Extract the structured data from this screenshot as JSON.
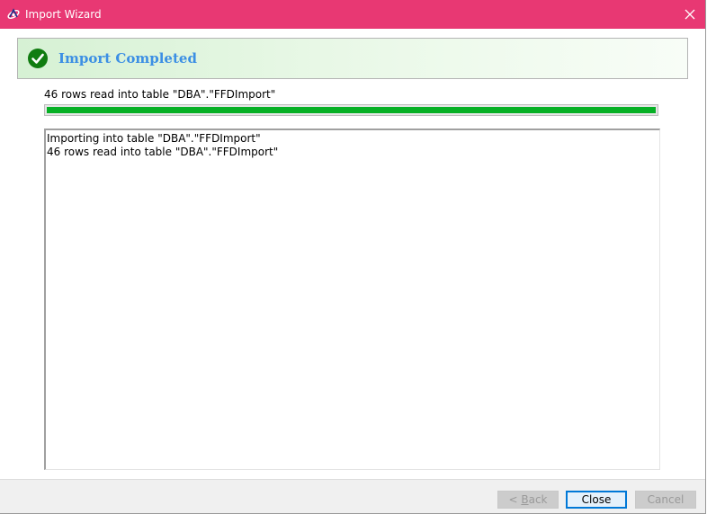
{
  "window": {
    "title": "Import Wizard",
    "app_icon": "sybase-interactive-sql-icon",
    "close_icon": "close-icon",
    "titlebar_color": "#e83873"
  },
  "banner": {
    "title": "Import Completed",
    "status_icon": "check-circle-icon",
    "status_color": "#107c10"
  },
  "status": {
    "text": "46 rows read into table \"DBA\".\"FFDImport\"",
    "progress_percent": 100,
    "progress_color": "#06b025"
  },
  "log": {
    "lines": [
      "Importing into table \"DBA\".\"FFDImport\"",
      "46 rows read into table \"DBA\".\"FFDImport\""
    ]
  },
  "buttons": {
    "back": {
      "prefix": "< ",
      "mnemonic": "B",
      "rest": "ack",
      "enabled": false
    },
    "close": {
      "label": "Close",
      "enabled": true,
      "default": true
    },
    "cancel": {
      "label": "Cancel",
      "enabled": false
    }
  }
}
